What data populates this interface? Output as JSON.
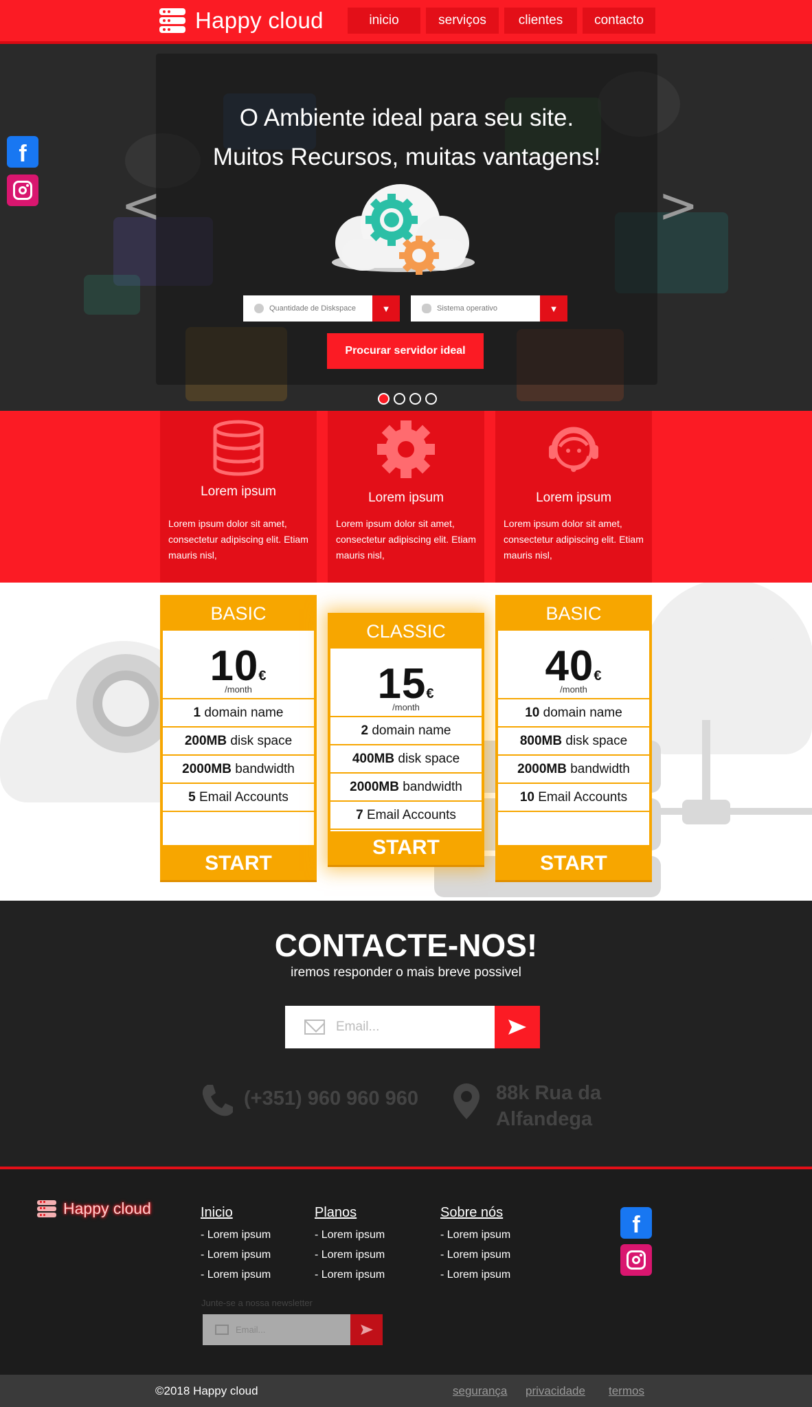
{
  "header": {
    "logo_text": "Happy cloud",
    "nav": [
      "inicio",
      "serviços",
      "clientes",
      "contacto"
    ]
  },
  "hero": {
    "title_line1": "O Ambiente ideal para seu site.",
    "title_line2": "Muitos Recursos, muitas vantagens!",
    "select_diskspace": "Quantidade de Diskspace",
    "select_os": "Sistema operativo",
    "search_button": "Procurar servidor ideal",
    "prev_arrow": "<",
    "next_arrow": ">",
    "slides": 4,
    "active_slide": 1
  },
  "features": [
    {
      "icon": "database-icon",
      "title": "Lorem ipsum",
      "text": "Lorem ipsum dolor sit amet, consectetur adipiscing elit. Etiam mauris nisl,"
    },
    {
      "icon": "gear-icon",
      "title": "Lorem ipsum",
      "text": "Lorem ipsum dolor sit amet, consectetur adipiscing elit. Etiam mauris nisl,"
    },
    {
      "icon": "support-agent-icon",
      "title": "Lorem ipsum",
      "text": "Lorem ipsum dolor sit amet, consectetur adipiscing elit. Etiam mauris nisl,"
    }
  ],
  "plans": [
    {
      "name": "BASIC",
      "price": "10",
      "currency": "€",
      "period": "/month",
      "rows": [
        {
          "b": "1",
          "t": " domain name"
        },
        {
          "b": "200MB",
          "t": " disk space"
        },
        {
          "b": "2000MB",
          "t": " bandwidth"
        },
        {
          "b": "5",
          "t": " Email Accounts"
        }
      ],
      "cta": "START"
    },
    {
      "name": "CLASSIC",
      "price": "15",
      "currency": "€",
      "period": "/month",
      "rows": [
        {
          "b": "2",
          "t": " domain name"
        },
        {
          "b": "400MB",
          "t": " disk space"
        },
        {
          "b": "2000MB",
          "t": " bandwidth"
        },
        {
          "b": "7",
          "t": " Email Accounts"
        }
      ],
      "cta": "START"
    },
    {
      "name": "BASIC",
      "price": "40",
      "currency": "€",
      "period": "/month",
      "rows": [
        {
          "b": "10",
          "t": " domain name"
        },
        {
          "b": "800MB",
          "t": " disk space"
        },
        {
          "b": "2000MB",
          "t": " bandwidth"
        },
        {
          "b": "10",
          "t": " Email Accounts"
        }
      ],
      "cta": "START"
    }
  ],
  "contact": {
    "title": "CONTACTE-NOS!",
    "subtitle": "iremos responder o mais breve possivel",
    "email_placeholder": "Email...",
    "phone": "(+351) 960 960 960",
    "address_line1": "88k Rua da",
    "address_line2": "Alfandega"
  },
  "footer": {
    "logo_text": "Happy cloud",
    "columns": [
      {
        "head": "Inicio",
        "items": [
          "- Lorem ipsum",
          "- Lorem ipsum",
          "- Lorem ipsum"
        ]
      },
      {
        "head": "Planos",
        "items": [
          "- Lorem ipsum",
          "- Lorem ipsum",
          "- Lorem ipsum"
        ]
      },
      {
        "head": "Sobre nós",
        "items": [
          "- Lorem ipsum",
          "- Lorem ipsum",
          "- Lorem ipsum"
        ]
      }
    ],
    "newsletter_label": "Junte-se a nossa newsletter",
    "newsletter_placeholder": "Email...",
    "copyright": "©2018 Happy cloud",
    "legal": [
      "segurança",
      "privacidade",
      "termos"
    ]
  },
  "colors": {
    "brand_red": "#fb1b24",
    "dark_red": "#e30f18",
    "orange": "#f7a600",
    "facebook": "#1877f2",
    "instagram": "#d9166f"
  }
}
